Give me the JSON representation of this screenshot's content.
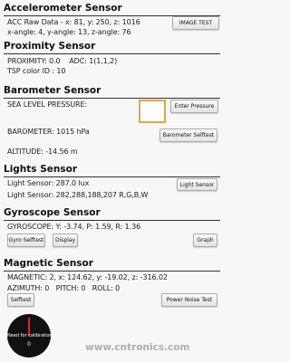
{
  "accelerometer": {
    "title": "Accelerometer Sensor",
    "raw": "ACC Raw Data - x: 81, y: 250, z: 1016",
    "angles": "x-angle: 4, y-angle: 13, z-angle: 76",
    "image_test_label": "IMAGE TEST"
  },
  "proximity": {
    "title": "Proximity Sensor",
    "values": "PROXIMITY: 0.0    ADC: 1(1,1,2)",
    "tsp_color": "TSP color ID : 10"
  },
  "barometer": {
    "title": "Barometer Sensor",
    "sea_level": "SEA LEVEL PRESSURE:",
    "enter_pressure_label": "Enter Pressure",
    "barometer": "BAROMETER: 1015 hPa",
    "selftest_label": "Barometer Selftest",
    "altitude": "ALTITUDE: -14.56 m"
  },
  "lights": {
    "title": "Lights Sensor",
    "lux": "Light Sensor: 287.0 lux",
    "rgbw": "Light Sensor: 282,288,188,207 R,G,B,W",
    "button_label": "Light Sensor"
  },
  "gyroscope": {
    "title": "Gyroscope Sensor",
    "values": "GYROSCOPE: Y: -3.74, P: 1.59, R: 1.36",
    "selftest_label": "Gyro Selftest",
    "display_label": "Display",
    "graph_label": "Graph"
  },
  "magnetic": {
    "title": "Magnetic Sensor",
    "values": "MAGNETIC: 2, x: 124.62, y: -19.02, z: -316.02",
    "orientation": "AZIMUTH: 0   PITCH: 0   ROLL: 0",
    "selftest_label": "Selftest",
    "power_noise_label": "Power Noise Test"
  },
  "compass": {
    "calibration_text": "Need for calibration",
    "degrees": "0"
  },
  "watermark": "www.cntronics.com",
  "colors": {
    "accent_box": "#e6a24a",
    "compass_bg": "#111111",
    "needle": "#e52222"
  }
}
